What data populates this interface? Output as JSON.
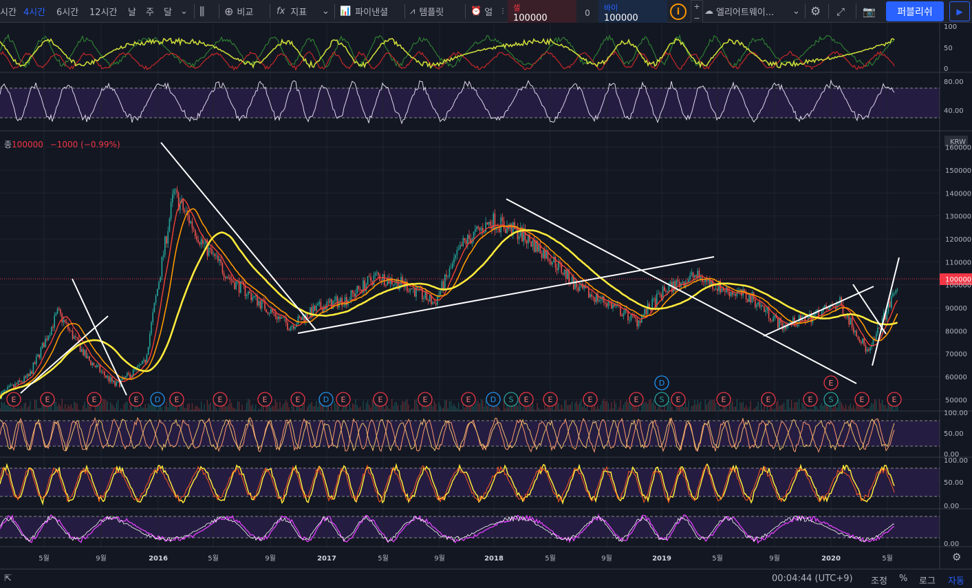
{
  "toolbar": {
    "intervals": [
      "시간",
      "4시간",
      "6시간",
      "12시간",
      "날",
      "주",
      "달"
    ],
    "active_interval": "4시간",
    "compare": "비교",
    "indicators": "지표",
    "pine_editor": "파이낸셜",
    "templates": "템플릿",
    "alert": "얼",
    "layout_name": "엘리어트웨이...",
    "publish": "퍼블리쉬"
  },
  "trade": {
    "sell_label": "셀",
    "sell_value": "100000",
    "spread": "0",
    "buy_label": "바이",
    "buy_value": "100000"
  },
  "legend": {
    "prefix": "종",
    "close": "100000",
    "change": "−1000 (−0.99%)"
  },
  "price_axis": {
    "currency": "KRW",
    "ticks": [
      "160000",
      "150000",
      "140000",
      "130000",
      "120000",
      "110000",
      "100000",
      "90000",
      "80000",
      "70000",
      "60000",
      "50000"
    ],
    "current_price": "100000"
  },
  "indicator_axes": {
    "dmi": [
      "100",
      "50",
      "0"
    ],
    "rsi": [
      "80.00",
      "40.00"
    ],
    "stoch1": [
      "100.00",
      "50.00",
      "0.00"
    ],
    "stoch2": [
      "100.00",
      "50.00",
      "0.00"
    ],
    "stoch3": [
      "0.00"
    ]
  },
  "time_axis": [
    "5월",
    "9월",
    "2016",
    "5월",
    "9월",
    "2017",
    "5월",
    "9월",
    "2018",
    "5월",
    "9월",
    "2019",
    "5월",
    "9월",
    "2020",
    "5월"
  ],
  "events": [
    "E",
    "E",
    "E",
    "E",
    "D",
    "E",
    "E",
    "E",
    "E",
    "D",
    "E",
    "E",
    "E",
    "E",
    "D",
    "S",
    "E",
    "E",
    "E",
    "E",
    "D",
    "S",
    "E",
    "E",
    "E",
    "E",
    "E",
    "S",
    "E",
    "E"
  ],
  "status": {
    "time": "00:04:44 (UTC+9)",
    "adjust": "조정",
    "percent": "%",
    "log": "로그",
    "auto": "자동"
  },
  "colors": {
    "bg": "#131722",
    "accent": "#2962ff",
    "down": "#f23645",
    "up": "#26a69a",
    "ma_yellow": "#ffeb3b",
    "ma_orange": "#ff9800",
    "ma_red": "#f44336"
  },
  "chart_data": {
    "type": "line",
    "series": [],
    "x": [
      "2015-03",
      "2015-05",
      "2015-07",
      "2015-09",
      "2015-11",
      "2016-01",
      "2016-03",
      "2016-05",
      "2016-07",
      "2016-09",
      "2016-11",
      "2017-01",
      "2017-03",
      "2017-05",
      "2017-07",
      "2017-09",
      "2017-11",
      "2018-01",
      "2018-03",
      "2018-05",
      "2018-07",
      "2018-09",
      "2018-11",
      "2019-01",
      "2019-03",
      "2019-05",
      "2019-07",
      "2019-09",
      "2019-11",
      "2020-01",
      "2020-03",
      "2020-05"
    ],
    "close": [
      52000,
      60000,
      88000,
      68000,
      56000,
      66000,
      140000,
      118000,
      102000,
      92000,
      82000,
      90000,
      94000,
      104000,
      100000,
      92000,
      118000,
      128000,
      122000,
      112000,
      98000,
      92000,
      84000,
      98000,
      104000,
      98000,
      94000,
      82000,
      86000,
      92000,
      70000,
      100000
    ],
    "ylim": [
      45000,
      165000
    ]
  }
}
